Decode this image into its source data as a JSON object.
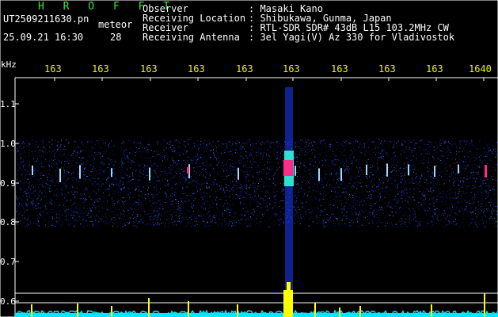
{
  "header": {
    "brand": "H R O F F T",
    "filename": "UT2509211630.pn",
    "mode_label": "meteor",
    "datetime": "25.09.21 16:30",
    "count": "28",
    "info": [
      {
        "label": "Observer",
        "value": ": Masaki Kano"
      },
      {
        "label": "Receiving Location",
        "value": ": Shibukawa, Gunma, Japan"
      },
      {
        "label": "Receiver",
        "value": ": RTL-SDR SDR# 43dB L15 103.2MHz CW"
      },
      {
        "label": "Receiving Antenna",
        "value": ": 3el Yagi(V) Az 330 for Vladivostok"
      }
    ]
  },
  "plot": {
    "y_unit": "kHz",
    "y_ticks": [
      "1.1",
      "1.0",
      "0.9",
      "0.8",
      "0.7",
      "0.6"
    ],
    "x_ticks": [
      "163",
      "163",
      "163",
      "163",
      "163",
      "163",
      "163",
      "163",
      "163",
      "1640"
    ],
    "colors": {
      "noise_dark": "#0a1e8a",
      "noise_light": "#3a6cff",
      "echo_core": "#ff2a8a",
      "echo_mid": "#2fe0d0",
      "power_trace": "#00e8ff",
      "power_spike": "#ffff00",
      "tick_labels": "#f0f000"
    }
  }
}
